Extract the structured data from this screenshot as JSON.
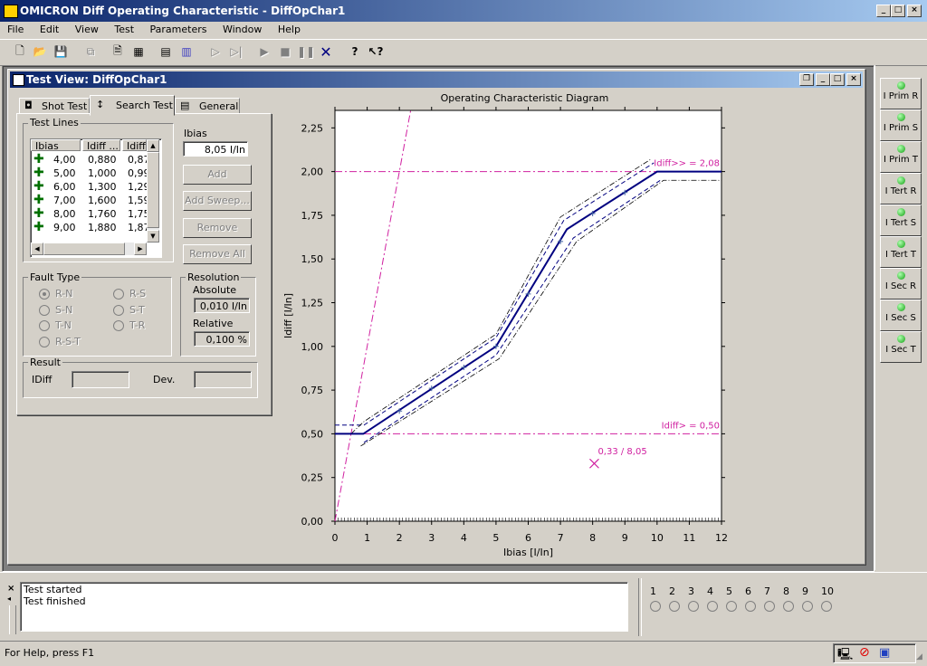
{
  "app_title": "OMICRON Diff Operating Characteristic - DiffOpChar1",
  "menu": [
    "File",
    "Edit",
    "View",
    "Test",
    "Parameters",
    "Window",
    "Help"
  ],
  "toolbar_icons": [
    "new-icon",
    "open-icon",
    "save-icon",
    "copy-icon",
    "report-icon",
    "table-icon",
    "calc-icon",
    "device-icon",
    "play-outline-icon",
    "step-icon",
    "play-icon",
    "stop-icon",
    "pause-icon",
    "clear-icon",
    "help-icon",
    "context-help-icon"
  ],
  "child": {
    "title": "Test View: DiffOpChar1"
  },
  "tabs": [
    "Shot Test",
    "Search Test",
    "General"
  ],
  "test_lines": {
    "label": "Test Lines",
    "columns": [
      "Ibias",
      "Idiff ...",
      "Idiff"
    ],
    "rows": [
      [
        "4,00",
        "0,880",
        "0,87"
      ],
      [
        "5,00",
        "1,000",
        "0,99"
      ],
      [
        "6,00",
        "1,300",
        "1,29"
      ],
      [
        "7,00",
        "1,600",
        "1,59"
      ],
      [
        "8,00",
        "1,760",
        "1,75"
      ],
      [
        "9,00",
        "1,880",
        "1,87"
      ]
    ]
  },
  "ibias": {
    "label": "Ibias",
    "value": "8,05  I/In"
  },
  "buttons": {
    "add": "Add",
    "add_sweep": "Add Sweep...",
    "remove": "Remove",
    "remove_all": "Remove All"
  },
  "fault_type": {
    "label": "Fault Type",
    "options": [
      "R-N",
      "R-S",
      "S-N",
      "S-T",
      "T-N",
      "T-R",
      "R-S-T"
    ],
    "selected": "R-N"
  },
  "resolution": {
    "label": "Resolution",
    "absolute_label": "Absolute",
    "absolute_value": "0,010  I/In",
    "relative_label": "Relative",
    "relative_value": "0,100  %"
  },
  "result": {
    "label": "Result",
    "idiff_label": "IDiff",
    "dev_label": "Dev."
  },
  "chart_data": {
    "type": "line",
    "title": "Operating Characteristic Diagram",
    "xlabel": "Ibias  [I/In]",
    "ylabel": "Idiff  [I/In]",
    "xlim": [
      0,
      12
    ],
    "ylim": [
      0,
      2.35
    ],
    "x_ticks": [
      "0",
      "1",
      "2",
      "3",
      "4",
      "5",
      "6",
      "7",
      "8",
      "9",
      "10",
      "11",
      "12"
    ],
    "y_ticks": [
      "0,00",
      "0,25",
      "0,50",
      "0,75",
      "1,00",
      "1,25",
      "1,50",
      "1,75",
      "2,00",
      "2,25"
    ],
    "characteristic": [
      [
        0,
        0.5
      ],
      [
        0.88,
        0.5
      ],
      [
        5,
        1.0
      ],
      [
        7.2,
        1.67
      ],
      [
        10,
        2.0
      ],
      [
        12,
        2.0
      ]
    ],
    "tolerance_upper_dashed": [
      [
        0,
        0.55
      ],
      [
        0.9,
        0.55
      ],
      [
        5,
        1.05
      ],
      [
        7.1,
        1.72
      ],
      [
        9.9,
        2.05
      ]
    ],
    "tolerance_lower_dashed": [
      [
        0.9,
        0.45
      ],
      [
        5,
        0.95
      ],
      [
        7.4,
        1.62
      ],
      [
        10.1,
        1.95
      ]
    ],
    "tolerance_upper_dashdot": [
      [
        0.5,
        0.5
      ],
      [
        0.9,
        0.57
      ],
      [
        5,
        1.07
      ],
      [
        7,
        1.74
      ],
      [
        9.8,
        2.07
      ]
    ],
    "tolerance_lower_dashdot": [
      [
        0.8,
        0.43
      ],
      [
        5.1,
        0.93
      ],
      [
        7.5,
        1.6
      ],
      [
        10.2,
        1.95
      ],
      [
        12,
        1.95
      ]
    ],
    "limit_lines": [
      {
        "label": "Idiff>> = 2,08",
        "y": 2.0
      },
      {
        "label": "Idiff> = 0,50",
        "y": 0.5
      }
    ],
    "diagonal_line": [
      [
        0,
        0
      ],
      [
        2.35,
        2.35
      ]
    ],
    "test_points": [
      [
        2,
        0.63
      ],
      [
        3,
        0.76
      ],
      [
        4,
        0.88
      ],
      [
        5,
        1.0
      ],
      [
        6,
        1.3
      ],
      [
        7,
        1.6
      ],
      [
        8,
        1.76
      ],
      [
        9,
        1.88
      ]
    ],
    "marker": {
      "x": 8.05,
      "y": 0.33,
      "label": "0,33 / 8,05"
    },
    "colors": {
      "characteristic": "#000080",
      "limits": "#d020a0",
      "points": "#4060a0"
    }
  },
  "side_buttons": [
    "I Prim R",
    "I Prim S",
    "I Prim T",
    "I Tert R",
    "I Tert S",
    "I Tert T",
    "I Sec R",
    "I Sec S",
    "I Sec T"
  ],
  "log": [
    "Test started",
    "Test finished"
  ],
  "channels": [
    "1",
    "2",
    "3",
    "4",
    "5",
    "6",
    "7",
    "8",
    "9",
    "10"
  ],
  "status": "For Help, press F1"
}
